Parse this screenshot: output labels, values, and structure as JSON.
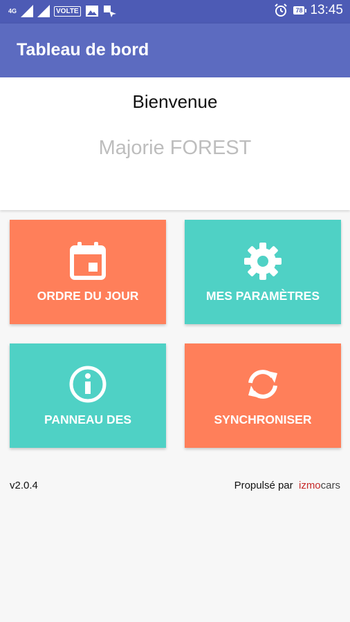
{
  "status_bar": {
    "network": "4G",
    "volte": "VOLTE",
    "battery": "78",
    "time": "13:45",
    "icons": [
      "signal-icon",
      "signal-icon",
      "image-icon",
      "notification-icon",
      "alarm-icon",
      "battery-icon"
    ]
  },
  "app_bar": {
    "title": "Tableau de bord"
  },
  "welcome": {
    "greeting": "Bienvenue",
    "user_name": "Majorie FOREST"
  },
  "tiles": [
    {
      "label": "ORDRE DU JOUR",
      "icon": "calendar-icon",
      "color": "#ff7f5a"
    },
    {
      "label": "MES PARAMÈTRES",
      "icon": "gear-icon",
      "color": "#4fd1c5"
    },
    {
      "label": "PANNEAU DES",
      "icon": "info-icon",
      "color": "#4fd1c5"
    },
    {
      "label": "SYNCHRONISER",
      "icon": "sync-icon",
      "color": "#ff7f5a"
    }
  ],
  "footer": {
    "version": "v2.0.4",
    "powered_by": "Propulsé par",
    "brand_part1": "izmo",
    "brand_part2": "cars"
  },
  "colors": {
    "status_bar": "#4d5bb5",
    "app_bar": "#5c6bc0",
    "orange": "#ff7f5a",
    "teal": "#4fd1c5"
  }
}
